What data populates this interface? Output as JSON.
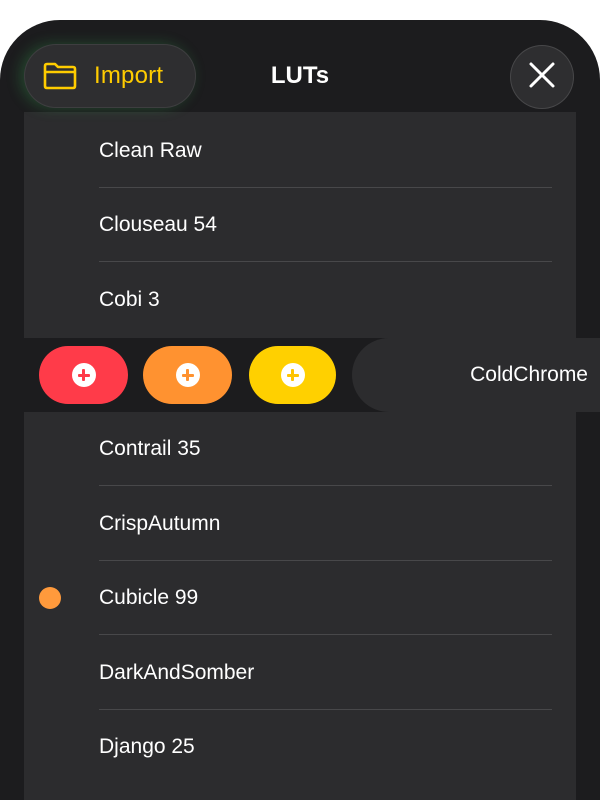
{
  "header": {
    "title": "LUTs",
    "import_label": "Import"
  },
  "colors": {
    "accent_yellow": "#ffcc00",
    "action_red": "#ff3b49",
    "action_orange": "#ff9230",
    "action_yellow": "#ffd000",
    "selected_dot": "#ff9a3c"
  },
  "list": {
    "items": [
      {
        "label": "Clean Raw"
      },
      {
        "label": "Clouseau 54"
      },
      {
        "label": "Cobi 3"
      },
      {
        "label": "ColdChrome",
        "swiped": true
      },
      {
        "label": "Contrail 35"
      },
      {
        "label": "CrispAutumn"
      },
      {
        "label": "Cubicle 99",
        "selected": true
      },
      {
        "label": "DarkAndSomber"
      },
      {
        "label": "Django 25"
      }
    ]
  },
  "swipe_actions": [
    {
      "name": "red",
      "icon": "plus-circle-icon"
    },
    {
      "name": "orange",
      "icon": "plus-circle-icon"
    },
    {
      "name": "yellow",
      "icon": "plus-circle-icon"
    }
  ]
}
